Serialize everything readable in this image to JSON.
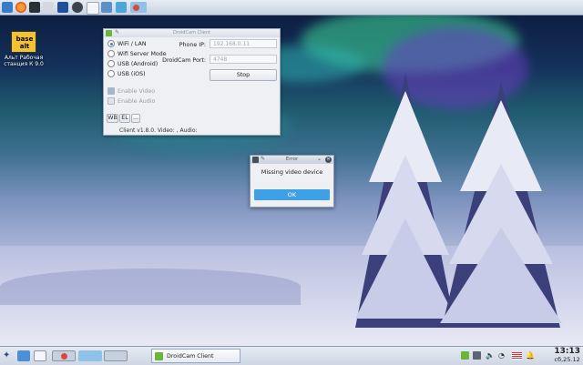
{
  "desktop": {
    "icon": {
      "logo_text": "base alt",
      "label_line1": "Альт Рабочая",
      "label_line2": "станция К 9.0"
    }
  },
  "top_panel": {
    "icons": [
      "app-menu-icon",
      "firefox-icon",
      "terminal-icon",
      "file-manager-icon",
      "calculator-icon",
      "network-icon",
      "document-icon",
      "text-editor-icon",
      "settings-icon",
      "folder-icon",
      "image-viewer-icon"
    ]
  },
  "droidcam": {
    "title": "DroidCam Client",
    "radios": [
      {
        "label": "WiFi / LAN",
        "selected": true
      },
      {
        "label": "Wifi Server Mode",
        "selected": false
      },
      {
        "label": "USB (Android)",
        "selected": false
      },
      {
        "label": "USB (iOS)",
        "selected": false
      }
    ],
    "enable_video": "Enable Video",
    "enable_audio": "Enable Audio",
    "phone_ip_label": "Phone IP:",
    "phone_ip_value": "192.168.0.11",
    "port_label": "DroidCam Port:",
    "port_value": "4748",
    "stop_label": "Stop",
    "btn_wb": "WB",
    "btn_el": "EL",
    "btn_more": "...",
    "status": "Client v1.8.0. Video: , Audio:"
  },
  "error_dialog": {
    "title": "Error",
    "message": "Missing video device",
    "ok_label": "OK"
  },
  "taskbar": {
    "task_label": "DroidCam Client",
    "time": "13:13",
    "date": "сб,25.12"
  },
  "colors": {
    "accent": "#3ea1e6",
    "droidcam_icon": "#6bb53b"
  }
}
